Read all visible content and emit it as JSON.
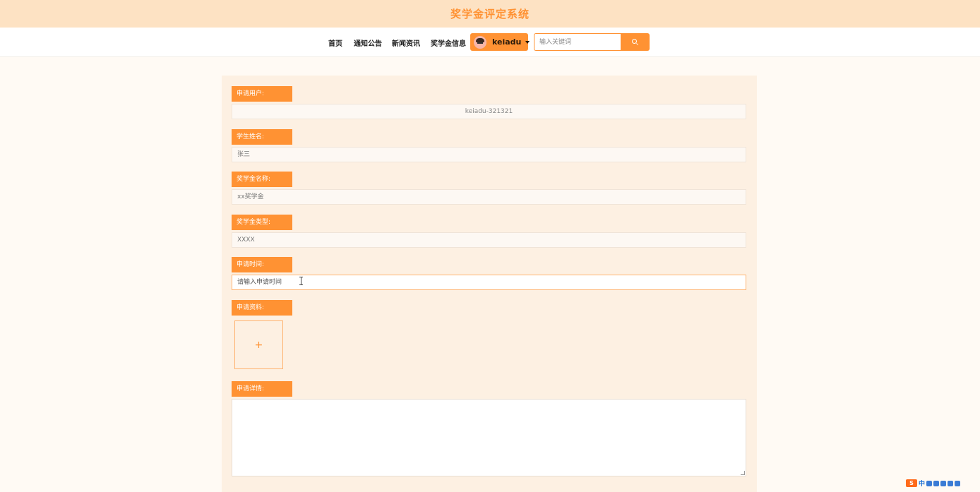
{
  "header": {
    "site_title": "奖学金评定系统"
  },
  "nav": {
    "items": [
      {
        "label": "首页"
      },
      {
        "label": "通知公告"
      },
      {
        "label": "新闻资讯"
      },
      {
        "label": "奖学金信息"
      }
    ],
    "user": {
      "name": "keiadu"
    },
    "search": {
      "placeholder": "输入关键词"
    }
  },
  "form": {
    "fields": [
      {
        "label": "申请用户:",
        "value": "keiadu-321321"
      },
      {
        "label": "学生姓名:",
        "value": "张三"
      },
      {
        "label": "奖学金名称:",
        "value": "xx奖学金"
      },
      {
        "label": "奖学金类型:",
        "value": "XXXX"
      },
      {
        "label": "申请时间:",
        "value": "",
        "placeholder": "请输入申请时间"
      }
    ],
    "upload": {
      "label": "申请资料:",
      "plus": "+"
    },
    "details": {
      "label": "申请详情:",
      "value": ""
    }
  },
  "ime": {
    "logo": "S",
    "mode": "中"
  },
  "colors": {
    "accent": "#ff9233",
    "banner_bg": "#fde2c3",
    "panel_bg": "#fdf0e2",
    "page_bg": "#fffaf4"
  }
}
